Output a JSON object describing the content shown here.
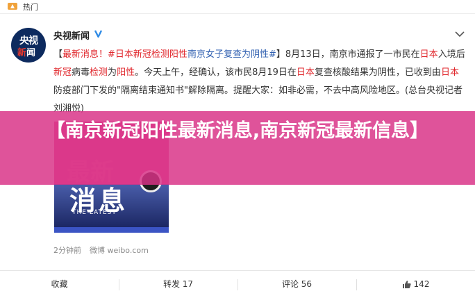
{
  "topbar": {
    "label": "热门",
    "icon": "fire-icon"
  },
  "author": {
    "name": "央视新闻",
    "avatar_line1": "央视",
    "avatar_line2_a": "新",
    "avatar_line2_b": "闻",
    "verified_icon": "verified-v-icon"
  },
  "post": {
    "seg1": "【",
    "seg2": "最新消息！",
    "seg3": "#日本新冠检测阳性",
    "seg4": "南京女子复查为阴性#",
    "seg5": "】8月13日，南京市通报了一市民在",
    "seg6": "日本",
    "seg7": "入境后",
    "seg8": "新冠",
    "seg9": "病毒",
    "seg10": "检测",
    "seg11": "为",
    "seg12": "阳性",
    "seg13": "。今天上午，经确认，该市民8月19日在",
    "seg14": "日本",
    "seg15": "复查核酸结果为阴性，已收到由",
    "seg16": "日本",
    "seg17": "防疫部门下发的\"隔离结束通知书\"解除隔离。提醒大家：如非必需，不去中高风险地区。(总台央视记者刘湘悦)"
  },
  "thumbnail": {
    "glyph1": "最新",
    "glyph2": "消息",
    "caption": "THE LATEST"
  },
  "banner": {
    "title": "【南京新冠阳性最新消息,南京新冠最新信息】"
  },
  "meta": {
    "time": "2分钟前",
    "source": "微博 weibo.com"
  },
  "actions": {
    "favorite": "收藏",
    "repost": "转发 17",
    "comment": "评论 56",
    "like": "142"
  },
  "colors": {
    "banner": "#d93287",
    "highlight_red": "#e0262b",
    "link_blue": "#2f5fb0"
  }
}
